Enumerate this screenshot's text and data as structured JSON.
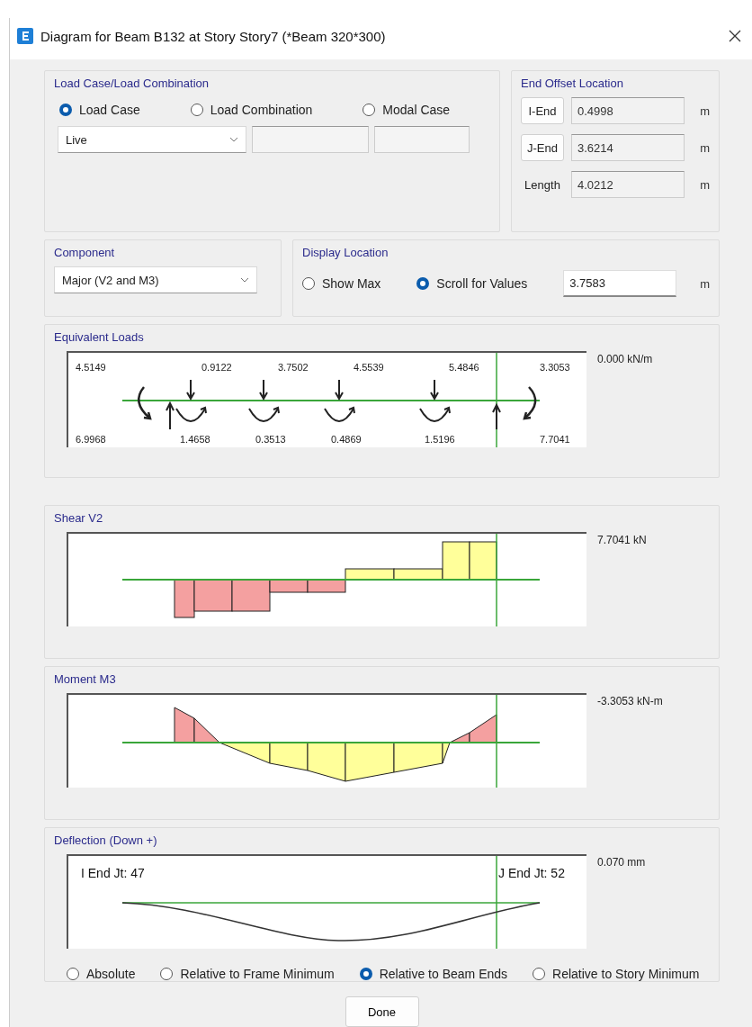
{
  "window": {
    "title": "Diagram for Beam B132 at Story Story7 (*Beam 320*300)"
  },
  "load_case": {
    "title": "Load Case/Load Combination",
    "options": [
      {
        "label": "Load Case",
        "selected": true
      },
      {
        "label": "Load Combination",
        "selected": false
      },
      {
        "label": "Modal Case",
        "selected": false
      }
    ],
    "dropdown": {
      "value": "Live"
    }
  },
  "end_offset": {
    "title": "End Offset Location",
    "rows": [
      {
        "kind": "button",
        "label": "I-End",
        "value": "0.4998",
        "unit": "m"
      },
      {
        "kind": "button",
        "label": "J-End",
        "value": "3.6214",
        "unit": "m"
      },
      {
        "kind": "label",
        "label": "Length",
        "value": "4.0212",
        "unit": "m"
      }
    ]
  },
  "component": {
    "title": "Component",
    "dropdown": {
      "value": "Major (V2 and M3)"
    }
  },
  "display_location": {
    "title": "Display Location",
    "options": [
      {
        "label": "Show Max",
        "selected": false
      },
      {
        "label": "Scroll for Values",
        "selected": true
      }
    ],
    "value": "3.7583",
    "unit": "m"
  },
  "equivalent_loads": {
    "title": "Equivalent Loads",
    "top_labels": [
      "4.5149",
      "0.9122",
      "3.7502",
      "4.5539",
      "5.4846",
      "3.3053"
    ],
    "bottom_labels": [
      "6.9968",
      "1.4658",
      "0.3513",
      "0.4869",
      "1.5196",
      "7.7041"
    ],
    "reading": "0.000 kN/m"
  },
  "shear": {
    "title": "Shear V2",
    "reading": "7.7041 kN"
  },
  "moment": {
    "title": "Moment M3",
    "reading": "-3.3053 kN-m"
  },
  "deflection": {
    "title": "Deflection (Down +)",
    "i_end": "I End Jt: 47",
    "j_end": "J End Jt: 52",
    "reading": "0.070 mm",
    "options": [
      {
        "label": "Absolute",
        "selected": false
      },
      {
        "label": "Relative to Frame Minimum",
        "selected": false
      },
      {
        "label": "Relative to Beam Ends",
        "selected": true
      },
      {
        "label": "Relative to Story Minimum",
        "selected": false
      }
    ]
  },
  "buttons": [
    "Done"
  ]
}
